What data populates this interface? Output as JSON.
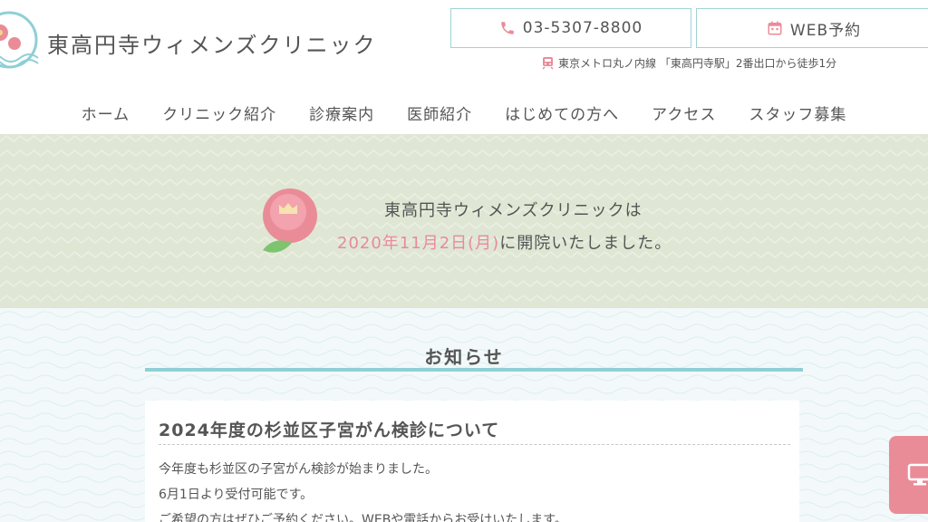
{
  "header": {
    "site_title": "東高円寺ウィメンズクリニック",
    "tel_label": "03-5307-8800",
    "web_label": "WEB予約",
    "access_text": "東京メトロ丸ノ内線 「東高円寺駅」2番出口から徒歩1分"
  },
  "nav": {
    "items": [
      "ホーム",
      "クリニック紹介",
      "診療案内",
      "医師紹介",
      "はじめての方へ",
      "アクセス",
      "スタッフ募集"
    ]
  },
  "hero": {
    "line1": "東高円寺ウィメンズクリニックは",
    "date": "2020年11月2日(月)",
    "line2_suffix": "に開院いたしました。"
  },
  "news": {
    "heading": "お知らせ",
    "post": {
      "title": "2024年度の杉並区子宮がん検診について",
      "body": [
        "今年度も杉並区の子宮がん検診が始まりました。",
        "6月1日より受付可能です。",
        "ご希望の方はぜひご予約ください。WEBや電話からお受けいたします。"
      ]
    }
  },
  "icons": {
    "tel": "phone-icon",
    "web": "calendar-icon",
    "access": "train-icon",
    "float": "monitor-icon"
  },
  "colors": {
    "accent_teal": "#8fcfd6",
    "pink": "#e88a9c",
    "hero_bg": "#dfe7d4"
  }
}
